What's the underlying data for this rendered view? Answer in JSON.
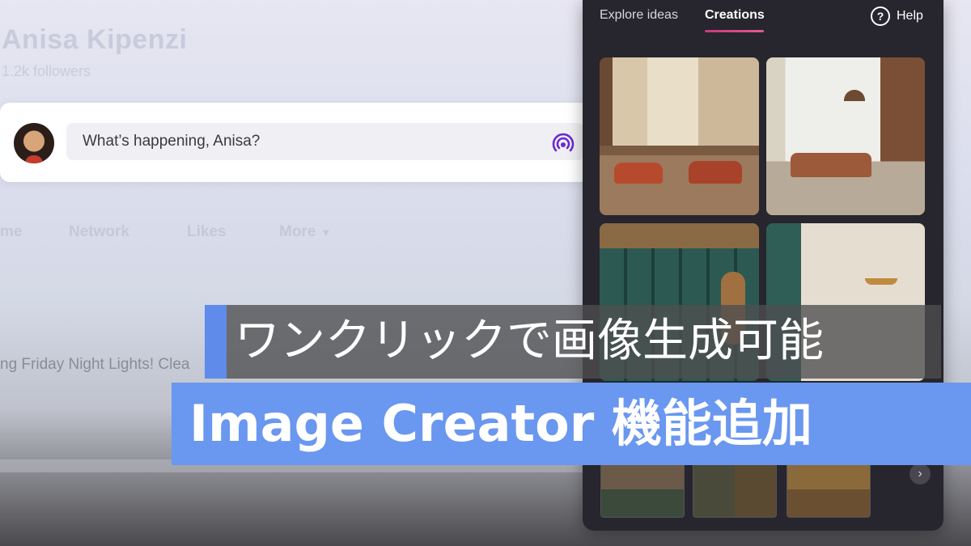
{
  "profile": {
    "name": "Anisa Kipenzi",
    "followers": "1.2k followers"
  },
  "composer": {
    "placeholder": "What’s happening, Anisa?"
  },
  "nav": {
    "tabs": [
      {
        "label": "me"
      },
      {
        "label": "Network"
      },
      {
        "label": "Likes"
      },
      {
        "label": "More"
      }
    ]
  },
  "feed": {
    "post_text": "ng Friday Night Lights! Clea"
  },
  "image_creator": {
    "tabs": [
      {
        "label": "Explore ideas",
        "active": false
      },
      {
        "label": "Creations",
        "active": true
      }
    ],
    "help_label": "Help",
    "accent_color": "#d24a84"
  },
  "banner": {
    "subtitle": "ワンクリックで画像生成可能",
    "title": "Image Creator 機能追加",
    "accent_color": "#6a97ef"
  }
}
